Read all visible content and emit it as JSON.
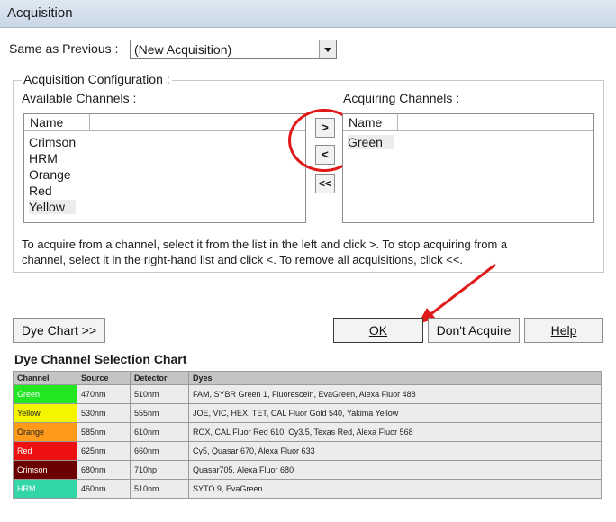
{
  "window": {
    "title": "Acquisition"
  },
  "same_as_previous": {
    "label": "Same as Previous :",
    "value": "(New Acquisition)"
  },
  "config": {
    "group_label": "Acquisition Configuration :",
    "available_label": "Available Channels :",
    "acquiring_label": "Acquiring Channels :",
    "name_header": "Name",
    "available_channels": [
      "Crimson",
      "HRM",
      "Orange",
      "Red",
      "Yellow"
    ],
    "acquiring_channels": [
      "Green"
    ],
    "buttons": {
      "add": ">",
      "remove": "<",
      "remove_all": "<<"
    },
    "instructions_line1": "To acquire from a channel, select it from the list in the left and click >. To stop acquiring from a",
    "instructions_line2": "channel, select it in the right-hand list and click <. To remove all acquisitions, click <<."
  },
  "actions": {
    "dye_chart": "Dye Chart >>",
    "ok": "OK",
    "dont_acquire": "Don't Acquire",
    "help": "Help"
  },
  "dye_chart": {
    "title": "Dye Channel Selection Chart",
    "headers": [
      "Channel",
      "Source",
      "Detector",
      "Dyes"
    ],
    "rows": [
      {
        "channel": "Green",
        "color": "#22e622",
        "source": "470nm",
        "detector": "510nm",
        "dyes": "FAM, SYBR Green 1, Fluorescein, EvaGreen, Alexa Fluor 488"
      },
      {
        "channel": "Yellow",
        "color": "#f5f500",
        "source": "530nm",
        "detector": "555nm",
        "dyes": "JOE, VIC, HEX, TET, CAL Fluor Gold 540, Yakima Yellow"
      },
      {
        "channel": "Orange",
        "color": "#ff9a1a",
        "source": "585nm",
        "detector": "610nm",
        "dyes": "ROX, CAL Fluor Red 610, Cy3.5, Texas Red, Alexa Fluor 568"
      },
      {
        "channel": "Red",
        "color": "#ee1111",
        "source": "625nm",
        "detector": "660nm",
        "dyes": "Cy5, Quasar 670, Alexa Fluor 633"
      },
      {
        "channel": "Crimson",
        "color": "#6a0000",
        "source": "680nm",
        "detector": "710hp",
        "dyes": "Quasar705, Alexa Fluor 680"
      },
      {
        "channel": "HRM",
        "color": "#33d6a8",
        "source": "460nm",
        "detector": "510nm",
        "dyes": "SYTO 9, EvaGreen"
      }
    ]
  },
  "colors": {
    "annotation": "#e01919",
    "titlebar": "#c9d7e6"
  }
}
